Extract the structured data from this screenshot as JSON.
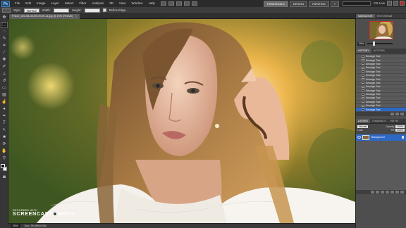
{
  "menubar": {
    "logo": "Ps",
    "items": [
      "File",
      "Edit",
      "Image",
      "Layer",
      "Select",
      "Filter",
      "Analysis",
      "3D",
      "View",
      "Window",
      "Help"
    ],
    "workspaces": [
      "ESSENTIALS",
      "DESIGN",
      "PAINTING"
    ],
    "workspace_more": "»",
    "cs_live": "CS Live"
  },
  "options": {
    "style_label": "Style:",
    "style_value": "Normal",
    "width_label": "Width:",
    "height_label": "Height:",
    "refine_label": "Refine Edge...",
    "antialias_label": "Anti-alias"
  },
  "document": {
    "tab_title": "Frisch_020-08-08-09-09-09-11.jpg @ 25% (RGB/8)",
    "tab_close": "×",
    "zoom": "25%",
    "status": "Doc: 39.5M/39.5M"
  },
  "watermark": {
    "line1": "RECORDED WITH",
    "line2a": "SCREENCAST",
    "line2b": "MATIC"
  },
  "navigator": {
    "tabs": [
      "NAVIGATOR",
      "HISTOGRAM"
    ],
    "zoom": "25%"
  },
  "history": {
    "tabs": [
      "HISTORY",
      "ACTIONS"
    ],
    "items": [
      "Smudge Tool",
      "Smudge Tool",
      "Smudge Tool",
      "Smudge Tool",
      "Smudge Tool",
      "Smudge Tool",
      "Smudge Tool",
      "Smudge Tool",
      "Smudge Tool",
      "Smudge Tool",
      "Smudge Tool",
      "Smudge Tool",
      "Smudge Tool",
      "Smudge Tool",
      "Smudge Tool"
    ]
  },
  "layers": {
    "tabs": [
      "LAYERS",
      "CHANNELS",
      "PATHS"
    ],
    "blend": "Normal",
    "opacity_label": "Opacity:",
    "opacity": "100%",
    "lock_label": "Lock:",
    "fill_label": "Fill:",
    "fill": "100%",
    "layer_name": "Background"
  },
  "colors": {
    "selection": "#2d68c4",
    "panel_bg": "#4e4e4e",
    "menubar_bg": "#2b2b2b"
  }
}
